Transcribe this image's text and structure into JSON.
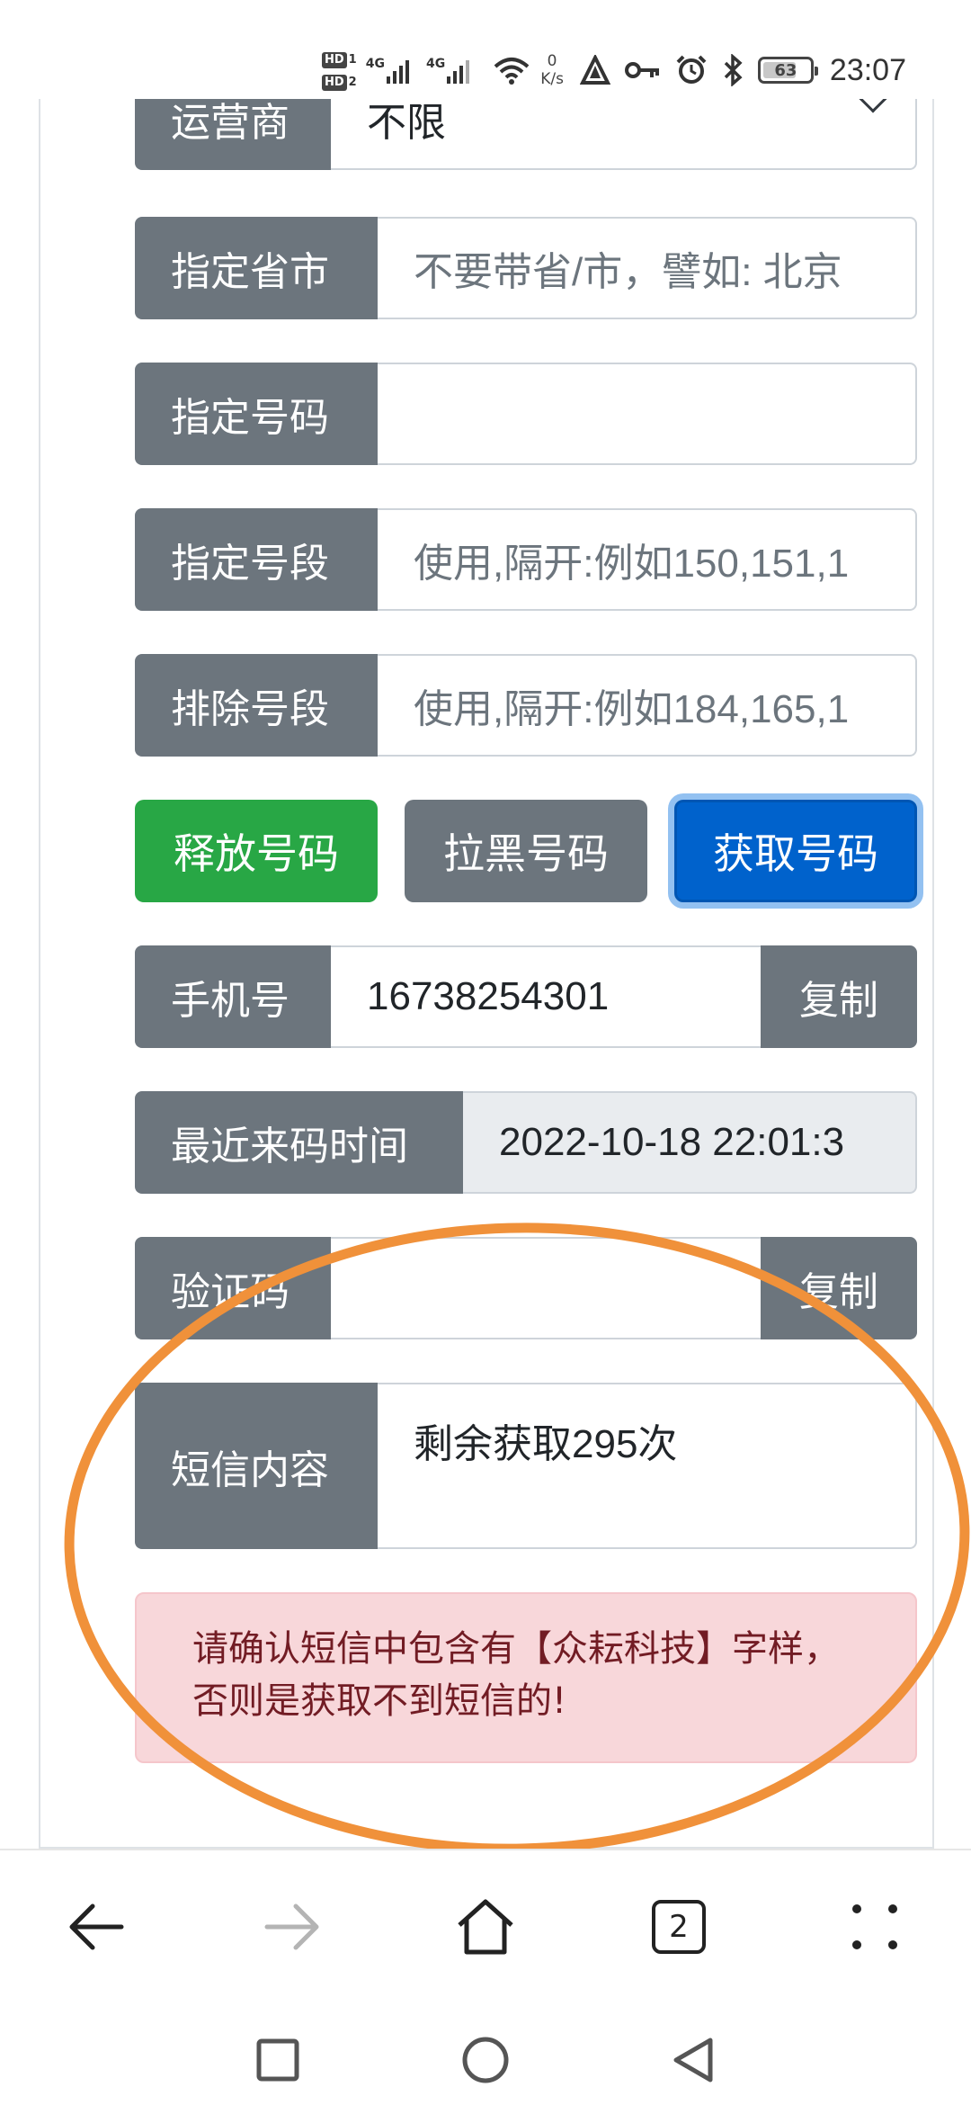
{
  "status_bar": {
    "hd1": "HD",
    "hd1_num": "1",
    "hd2": "HD",
    "hd2_num": "2",
    "net1": "4G",
    "net2": "4G",
    "speed_value": "0",
    "speed_unit": "K/s",
    "battery": "63",
    "time": "23:07"
  },
  "form": {
    "carrier_label": "运营商",
    "carrier_value": "不限",
    "province_label": "指定省市",
    "province_placeholder": "不要带省/市，譬如: 北京",
    "number_label": "指定号码",
    "number_value": "",
    "prefix_label": "指定号段",
    "prefix_placeholder": "使用,隔开:例如150,151,1",
    "exclude_label": "排除号段",
    "exclude_placeholder": "使用,隔开:例如184,165,1",
    "release_button": "释放号码",
    "blacklist_button": "拉黑号码",
    "get_button": "获取号码",
    "phone_label": "手机号",
    "phone_value": "16738254301",
    "copy_label": "复制",
    "last_time_label": "最近来码时间",
    "last_time_value": "2022-10-18 22:01:3",
    "code_label": "验证码",
    "code_value": "",
    "code_copy_label": "复制",
    "sms_label": "短信内容",
    "sms_value": "剩余获取295次"
  },
  "alert": {
    "text": "请确认短信中包含有【众耘科技】字样，否则是获取不到短信的!"
  },
  "browser_nav": {
    "tab_count": "2"
  },
  "colors": {
    "addon_gray": "#6c757d",
    "success": "#28a745",
    "primary": "#0062cc",
    "alert_bg": "#f8d7da",
    "alert_text": "#721c24",
    "annotation": "#f0913a"
  },
  "icons": {
    "back": "back-arrow-icon",
    "forward": "forward-arrow-icon",
    "home": "home-icon",
    "tabs": "tabs-icon",
    "menu": "more-menu-icon",
    "recents": "recents-square-icon",
    "sys_home": "home-circle-icon",
    "sys_back": "back-triangle-icon"
  }
}
